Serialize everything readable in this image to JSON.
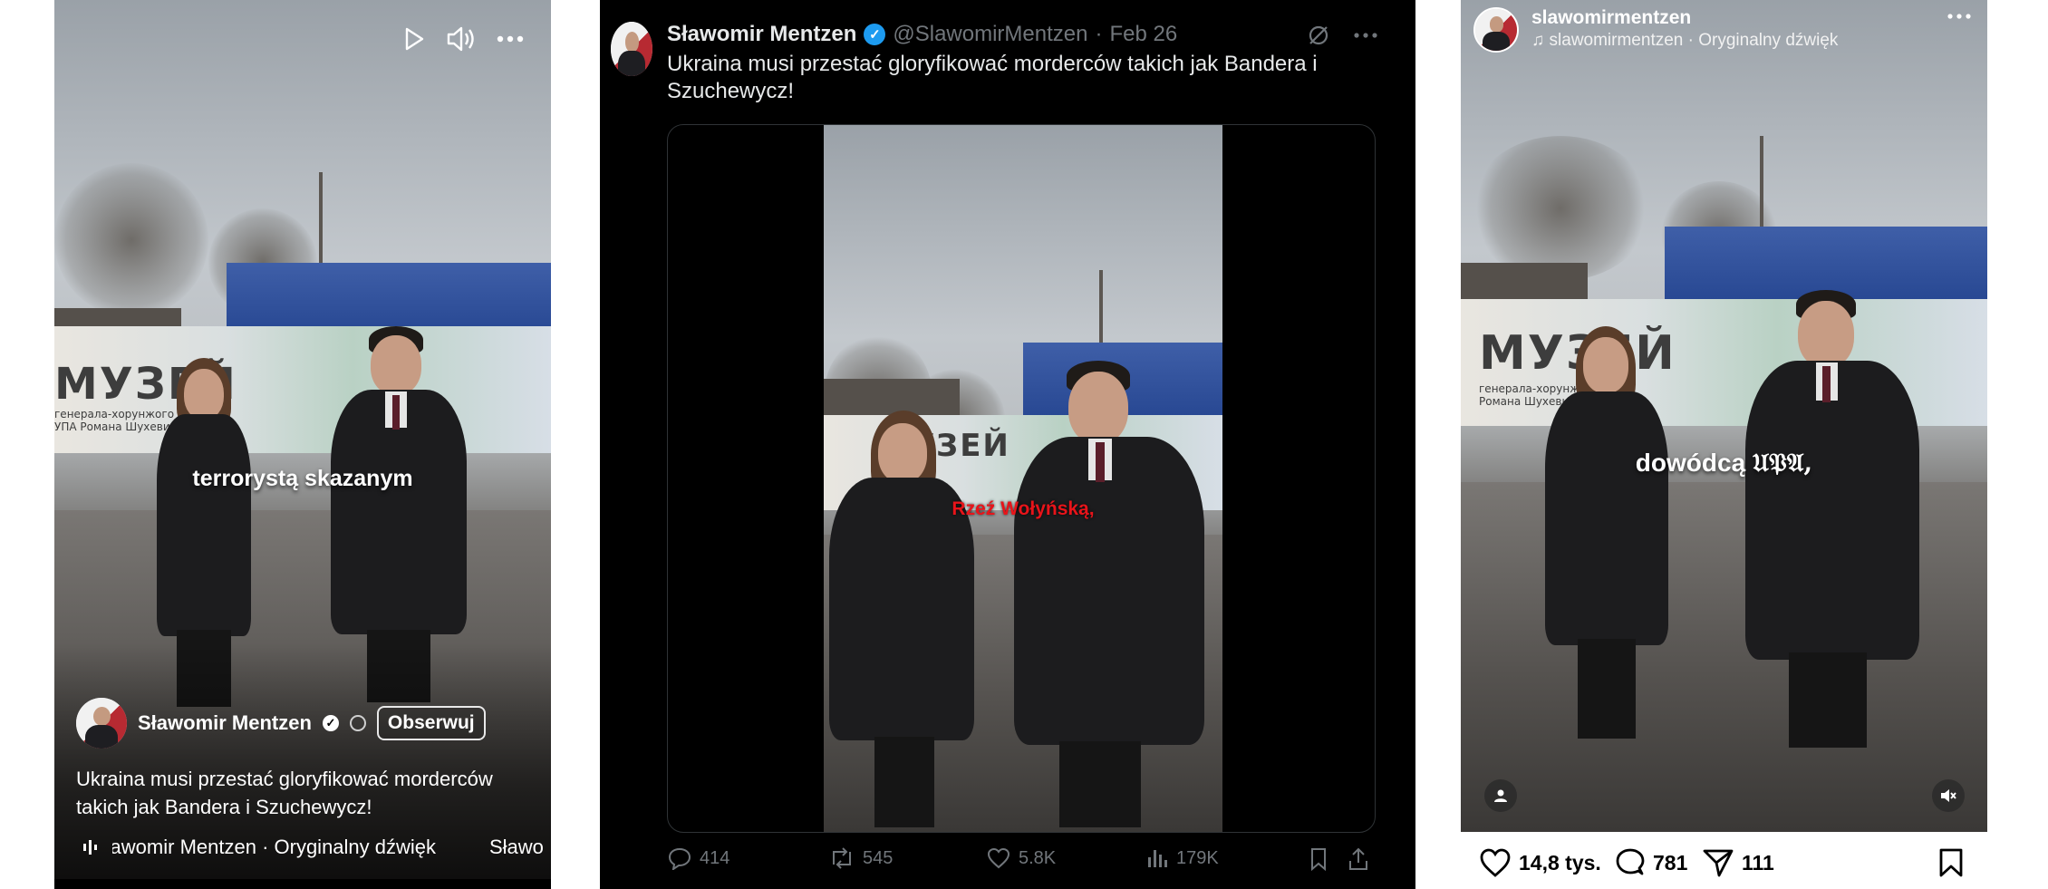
{
  "panel1": {
    "caption": "terrorystą skazanym",
    "user_name": "Sławomir Mentzen",
    "follow_label": "Obserwuj",
    "post_text": "Ukraina musi przestać gloryfikować morderców takich jak Bandera i Szuchewycz!",
    "audio_text": "Sławomir Mentzen · Oryginalny dźwięk",
    "audio_text_2": "Sławo",
    "banner_text": "МУЗЕЙ",
    "banner_subtext": "генерала-хорунжого УПА Романа Шухевича",
    "icons": [
      "play-icon",
      "volume-icon",
      "more-icon",
      "verified-icon",
      "globe-icon",
      "sound-wave-icon"
    ]
  },
  "panel2": {
    "author_name": "Sławomir Mentzen",
    "handle": "@SlawomirMentzen",
    "separator": "·",
    "date": "Feb 26",
    "tweet_text": "Ukraina musi przestać gloryfikować morderców takich jak Bandera i Szuchewycz!",
    "caption": "Rzeź Wołyńską,",
    "caption_color": "#e8141a",
    "accent_color": "#1d9bf0",
    "replies": "414",
    "reposts": "545",
    "likes": "5.8K",
    "views": "179K",
    "icons": [
      "grok-icon",
      "more-icon",
      "reply-icon",
      "repost-icon",
      "like-icon",
      "views-icon",
      "bookmark-icon",
      "share-icon"
    ]
  },
  "panel3": {
    "username": "slawomirmentzen",
    "audio_text": "slawomirmentzen · Oryginalny dźwięk",
    "caption_prefix": "dowódcą",
    "caption_suffix": "𝔘𝔓𝔄,",
    "banner_text": "МУЗЕЙ",
    "banner_subtext": "генерала-хорунжого УПА Романа Шухевича",
    "likes": "14,8 tys.",
    "comments": "781",
    "shares": "111",
    "icons": [
      "music-note-icon",
      "more-icon",
      "tag-people-icon",
      "muted-icon",
      "heart-icon",
      "comment-icon",
      "share-icon",
      "bookmark-icon"
    ]
  }
}
